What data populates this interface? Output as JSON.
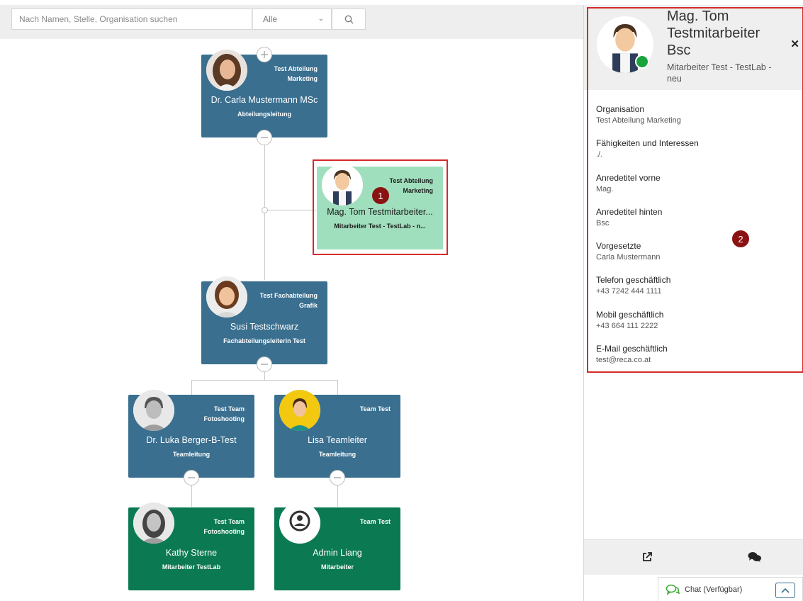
{
  "search": {
    "placeholder": "Nach Namen, Stelle, Organisation suchen",
    "filter_selected": "Alle"
  },
  "markers": [
    "1",
    "2"
  ],
  "nodes": {
    "carla": {
      "dept": "Test Abteilung Marketing",
      "name": "Dr. Carla Mustermann MSc",
      "role": "Abteilungsleitung"
    },
    "tom": {
      "dept": "Test Abteilung Marketing",
      "name": "Mag. Tom Testmitarbeiter...",
      "role": "Mitarbeiter Test - TestLab - n..."
    },
    "susi": {
      "dept": "Test Fachabteilung Grafik",
      "name": "Susi Testschwarz",
      "role": "Fachabteilungsleiterin Test"
    },
    "luka": {
      "dept": "Test Team Fotoshooting",
      "name": "Dr. Luka Berger-B-Test",
      "role": "Teamleitung"
    },
    "lisa": {
      "dept": "Team Test",
      "name": "Lisa Teamleiter",
      "role": "Teamleitung"
    },
    "kathy": {
      "dept": "Test Team Fotoshooting",
      "name": "Kathy Sterne",
      "role": "Mitarbeiter TestLab"
    },
    "admin": {
      "dept": "Team Test",
      "name": "Admin Liang",
      "role": "Mitarbeiter"
    }
  },
  "colors": {
    "node_blue": "#3a6f8f",
    "node_green": "#0b7a52",
    "node_selected": "#a0dfbd",
    "highlight": "#d32b2b",
    "status_online": "#19a43b"
  },
  "panel": {
    "name": "Mag. Tom Testmitarbeiter Bsc",
    "subtitle": "Mitarbeiter Test - TestLab - neu",
    "fields": [
      {
        "label": "Organisation",
        "value": "Test Abteilung Marketing"
      },
      {
        "label": "Fähigkeiten und Interessen",
        "value": "./."
      },
      {
        "label": "Anredetitel vorne",
        "value": "Mag."
      },
      {
        "label": "Anredetitel hinten",
        "value": "Bsc"
      },
      {
        "label": "Vorgesetzte",
        "value": "Carla Mustermann"
      },
      {
        "label": "Telefon geschäftlich",
        "value": "+43 7242 444 1111"
      },
      {
        "label": "Mobil geschäftlich",
        "value": "+43 664 111 2222"
      },
      {
        "label": "E-Mail geschäftlich",
        "value": "test@reca.co.at"
      }
    ]
  },
  "chat": {
    "label": "Chat (Verfügbar)"
  }
}
